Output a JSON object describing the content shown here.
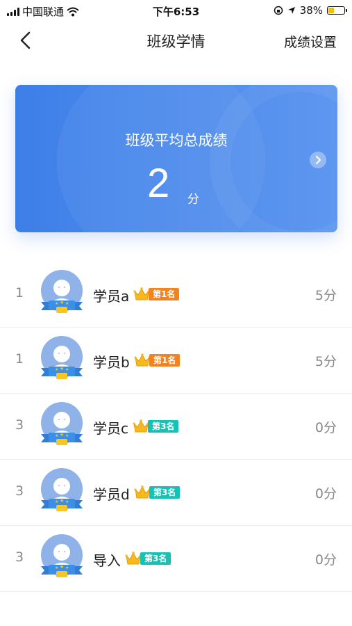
{
  "status": {
    "carrier": "中国联通",
    "time": "下午6:53",
    "battery": "38%",
    "battery_level": 0.38
  },
  "nav": {
    "title": "班级学情",
    "right_action": "成绩设置"
  },
  "summary": {
    "title": "班级平均总成绩",
    "score": "2",
    "unit": "分"
  },
  "students": [
    {
      "rank": "1",
      "name": "学员a",
      "badge": "第1名",
      "badge_color": "#f5821f",
      "score": "5分"
    },
    {
      "rank": "1",
      "name": "学员b",
      "badge": "第1名",
      "badge_color": "#f5821f",
      "score": "5分"
    },
    {
      "rank": "3",
      "name": "学员c",
      "badge": "第3名",
      "badge_color": "#14c3b5",
      "score": "0分"
    },
    {
      "rank": "3",
      "name": "学员d",
      "badge": "第3名",
      "badge_color": "#14c3b5",
      "score": "0分"
    },
    {
      "rank": "3",
      "name": "导入",
      "badge": "第3名",
      "badge_color": "#14c3b5",
      "score": "0分"
    }
  ]
}
